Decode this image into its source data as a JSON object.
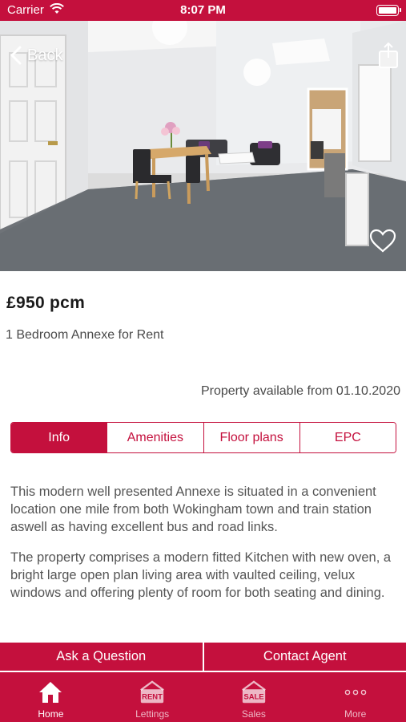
{
  "status_bar": {
    "carrier": "Carrier",
    "time": "8:07 PM"
  },
  "nav": {
    "back_label": "Back"
  },
  "listing": {
    "price": "£950 pcm",
    "title": "1 Bedroom Annexe for Rent",
    "availability": "Property available from 01.10.2020"
  },
  "tabs": [
    {
      "label": "Info",
      "active": true
    },
    {
      "label": "Amenities",
      "active": false
    },
    {
      "label": "Floor plans",
      "active": false
    },
    {
      "label": "EPC",
      "active": false
    }
  ],
  "description": [
    "This modern well presented Annexe is situated in a convenient location one mile from both Wokingham town and train station aswell as having excellent bus and road links.",
    "The property comprises a modern fitted Kitchen with new oven, a bright large open plan living area with vaulted ceiling, velux windows and offering plenty of room for both seating and dining."
  ],
  "actions": {
    "ask": "Ask a Question",
    "contact": "Contact Agent"
  },
  "tabbar": [
    {
      "label": "Home",
      "icon": "home-icon",
      "badge": "",
      "active": true
    },
    {
      "label": "Lettings",
      "icon": "lettings-icon",
      "badge": "RENT",
      "active": false
    },
    {
      "label": "Sales",
      "icon": "sales-icon",
      "badge": "SALE",
      "active": false
    },
    {
      "label": "More",
      "icon": "more-icon",
      "badge": "",
      "active": false
    }
  ],
  "colors": {
    "brand": "#c4103d",
    "text": "#333333",
    "muted": "#4a4a4a"
  }
}
